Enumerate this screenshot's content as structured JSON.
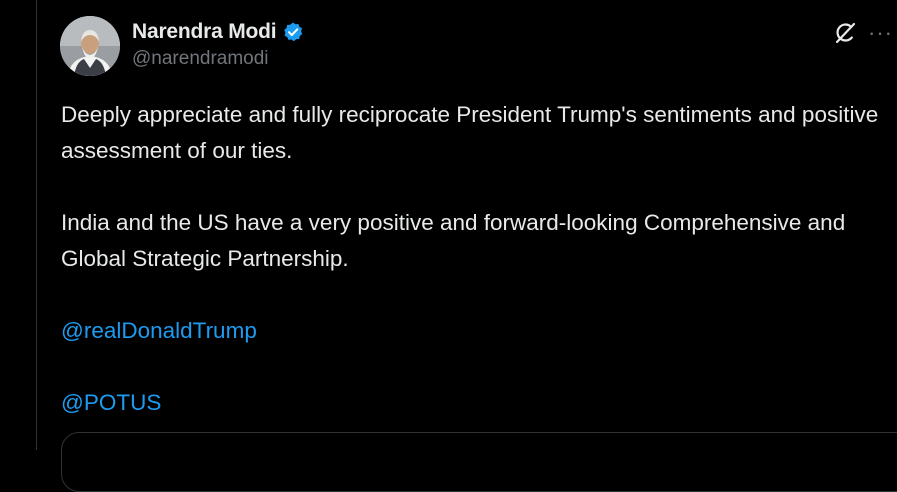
{
  "author": {
    "display_name": "Narendra Modi",
    "handle": "@narendramodi",
    "verified": true,
    "avatar_icon": "profile-photo"
  },
  "actions": {
    "grok_icon": "grok-icon",
    "more_icon": "more-dots-icon",
    "more_label": "···"
  },
  "tweet": {
    "paragraph_1": "Deeply appreciate and fully reciprocate President Trump's sentiments and positive assessment of our ties.",
    "paragraph_2": "India and the US have a very positive and forward-looking Comprehensive and Global Strategic Partnership.",
    "mention_1": "@realDonaldTrump",
    "mention_2": "@POTUS"
  },
  "colors": {
    "background": "#000000",
    "text_primary": "#e7e9ea",
    "text_secondary": "#71767b",
    "link": "#1d9bf0",
    "verified_badge": "#1d9bf0",
    "border": "#2f3336"
  }
}
